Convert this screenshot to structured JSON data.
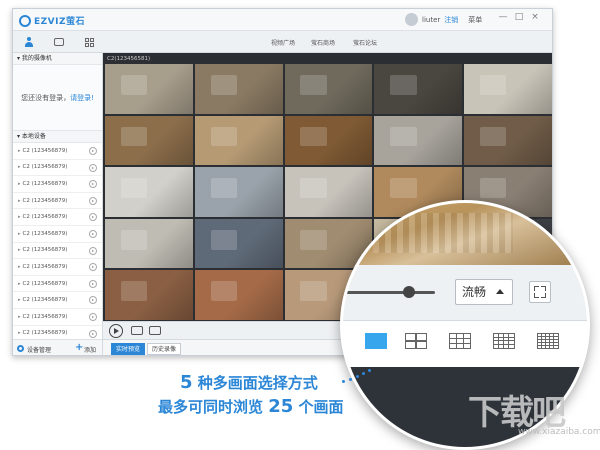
{
  "app": {
    "logo_text": "EZVIZ萤石",
    "user": "liuter",
    "logout": "注销",
    "menu": "菜单",
    "window_controls": [
      "—",
      "□",
      "×"
    ]
  },
  "toolbar": {
    "nav_links": [
      "视频广场",
      "萤石商场",
      "萤石论坛"
    ]
  },
  "sidebar": {
    "my_devices_header": "▾ 我的摄像机",
    "not_logged_in": "您还没有登录，",
    "login_prompt": "请登录!",
    "local_devices_header": "▾ 本地设备",
    "devices": [
      "C2 (123456879)",
      "C2 (123456879)",
      "C2 (123456879)",
      "C2 (123456879)",
      "C2 (123456879)",
      "C2 (123456879)",
      "C2 (123456879)",
      "C2 (123456879)",
      "C2 (123456879)",
      "C2 (123456879)",
      "C2 (123456879)",
      "C2 (123456879)"
    ],
    "device_manage": "设备管理",
    "add": "添加"
  },
  "content": {
    "camera_title": "C2(123456581)",
    "tiles": [
      "#a89e8c",
      "#8a7a63",
      "#6f6a5c",
      "#4a4640",
      "#c9c4b8",
      "#8c6e4b",
      "#b59a73",
      "#7f5a34",
      "#a8a49c",
      "#705c48",
      "#d2d0ca",
      "#9aa3ab",
      "#c7c3bb",
      "#b08a5d",
      "#8a7f73",
      "#bfbcb3",
      "#5f6a78",
      "#a08c70",
      "#c4b89e",
      "#3f4247",
      "#8a5f43",
      "#a56b48",
      "#b89a7a",
      "#2f3236",
      "#2f3236"
    ],
    "tabs": [
      "实时预览",
      "历史录像"
    ]
  },
  "magnifier": {
    "quality_label": "流畅",
    "layouts": [
      "1",
      "4",
      "9",
      "16",
      "25"
    ]
  },
  "caption": {
    "line1_num": "5",
    "line1_text": " 种多画面选择方式",
    "line2_text": "最多可同时浏览 ",
    "line2_num": "25",
    "line2_tail": " 个画面"
  },
  "watermark": {
    "text": "下载吧",
    "url": "www.xiazaiba.com"
  }
}
